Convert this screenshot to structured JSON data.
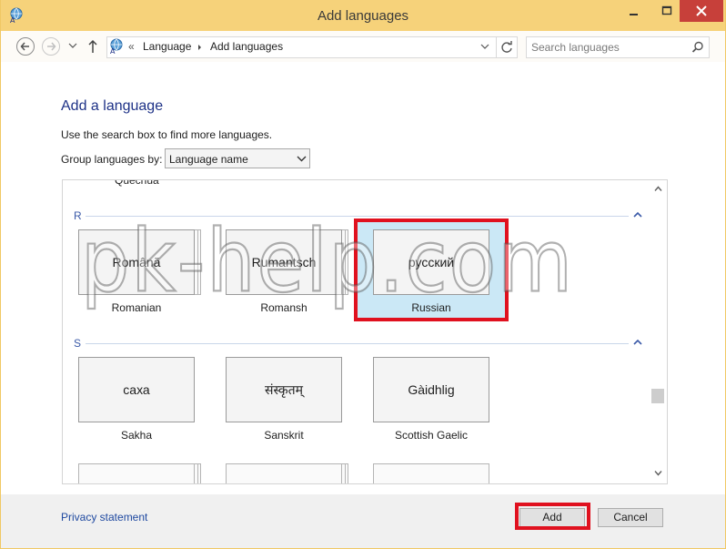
{
  "window": {
    "title": "Add languages"
  },
  "address": {
    "separator": "«",
    "crumbs": [
      "Language",
      "Add languages"
    ]
  },
  "search": {
    "placeholder": "Search languages"
  },
  "content": {
    "heading": "Add a language",
    "hint": "Use the search box to find more languages.",
    "group_label": "Group languages by:",
    "group_value": "Language name"
  },
  "list": {
    "cut_item": "Quechua",
    "groups": [
      {
        "letter": "R",
        "items": [
          {
            "native": "Română",
            "name": "Romanian",
            "selected": false
          },
          {
            "native": "Rumantsch",
            "name": "Romansh",
            "selected": false
          },
          {
            "native": "русский",
            "name": "Russian",
            "selected": true
          }
        ]
      },
      {
        "letter": "S",
        "items": [
          {
            "native": "саха",
            "name": "Sakha",
            "selected": false
          },
          {
            "native": "संस्कृतम्",
            "name": "Sanskrit",
            "selected": false
          },
          {
            "native": "Gàidhlig",
            "name": "Scottish Gaelic",
            "selected": false
          }
        ]
      }
    ]
  },
  "watermark": "pk-help.com",
  "footer": {
    "privacy": "Privacy statement",
    "add": "Add",
    "cancel": "Cancel"
  },
  "colors": {
    "accent": "#e0111f",
    "selection": "#cbe8f6",
    "title_bar": "#f6d27a",
    "link": "#1f49a0"
  }
}
